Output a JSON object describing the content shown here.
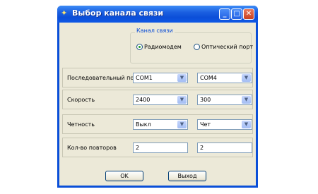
{
  "window": {
    "title": "Выбор канала связи",
    "title_buttons": {
      "minimize": "_",
      "maximize": "□",
      "close": "✕"
    }
  },
  "channel_group": {
    "label": "Канал связи",
    "options": [
      {
        "label": "Радиомодем",
        "selected": true
      },
      {
        "label": "Оптический порт",
        "selected": false
      }
    ]
  },
  "rows": {
    "serial_port": {
      "label": "Последовательный порт",
      "value1": "COM1",
      "value2": "COM4"
    },
    "speed": {
      "label": "Скорость",
      "value1": "2400",
      "value2": "300"
    },
    "parity": {
      "label": "Четность",
      "value1": "Выкл",
      "value2": "Чет"
    },
    "retries": {
      "label": "Кол-во повторов",
      "value1": "2",
      "value2": "2"
    }
  },
  "buttons": {
    "ok": "OK",
    "exit": "Выход"
  },
  "colors": {
    "titlebar": "#0b4ed8",
    "dialog_bg": "#ece9d8",
    "group_label": "#0046d5"
  }
}
